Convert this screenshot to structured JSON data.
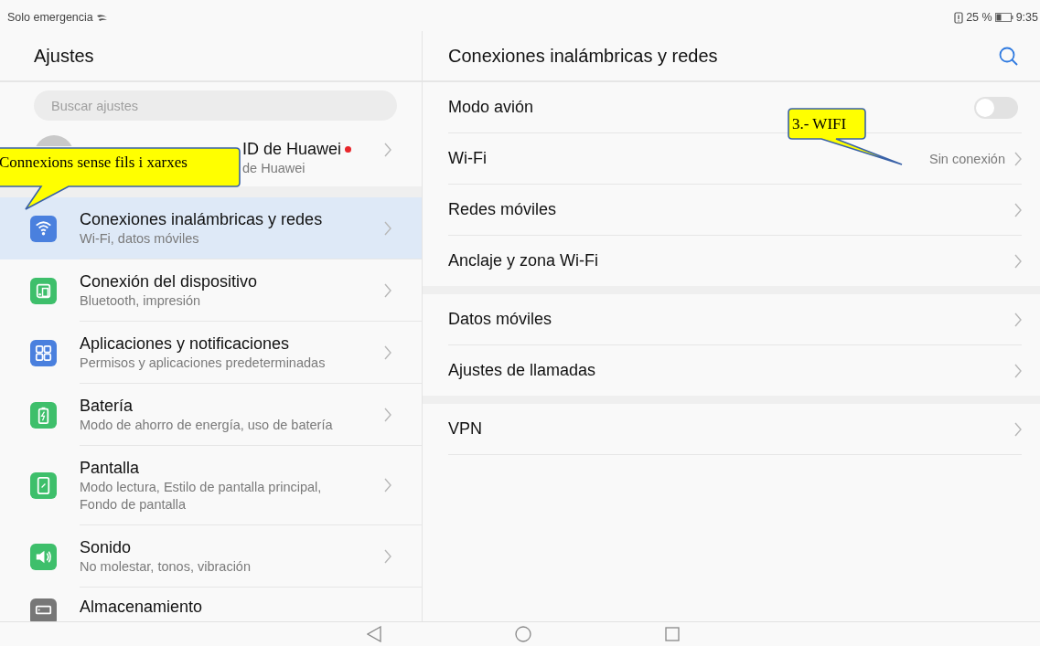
{
  "status_bar": {
    "carrier": "Solo emergencia",
    "battery_percent": "25 %",
    "time": "9:35"
  },
  "sidebar": {
    "title": "Ajustes",
    "search": {
      "placeholder": "Buscar ajustes"
    },
    "account": {
      "title": "ID de Huawei",
      "subtitle": "de Huawei",
      "notification_dot": true
    },
    "items": [
      {
        "title": "Conexiones inalámbricas y redes",
        "subtitle": "Wi-Fi, datos móviles",
        "selected": true
      },
      {
        "title": "Conexión del dispositivo",
        "subtitle": "Bluetooth, impresión",
        "selected": false
      },
      {
        "title": "Aplicaciones y notificaciones",
        "subtitle": "Permisos y aplicaciones predeterminadas",
        "selected": false
      },
      {
        "title": "Batería",
        "subtitle": "Modo de ahorro de energía, uso de batería",
        "selected": false
      },
      {
        "title": "Pantalla",
        "subtitle": "Modo lectura, Estilo de pantalla principal, Fondo de pantalla",
        "selected": false
      },
      {
        "title": "Sonido",
        "subtitle": "No molestar, tonos, vibración",
        "selected": false
      },
      {
        "title": "Almacenamiento",
        "selected": false
      }
    ]
  },
  "detail": {
    "title": "Conexiones inalámbricas y redes",
    "groups": [
      [
        {
          "kind": "toggle",
          "label": "Modo avión",
          "on": false
        },
        {
          "kind": "link",
          "label": "Wi-Fi",
          "value": "Sin conexión"
        },
        {
          "kind": "link",
          "label": "Redes móviles"
        },
        {
          "kind": "link",
          "label": "Anclaje y zona Wi-Fi"
        }
      ],
      [
        {
          "kind": "link",
          "label": "Datos móviles"
        },
        {
          "kind": "link",
          "label": "Ajustes de llamadas"
        }
      ],
      [
        {
          "kind": "link",
          "label": "VPN"
        }
      ]
    ]
  },
  "annotations": [
    {
      "text": "Connexions sense fils i xarxes"
    },
    {
      "text": "3.- WIFI"
    }
  ]
}
